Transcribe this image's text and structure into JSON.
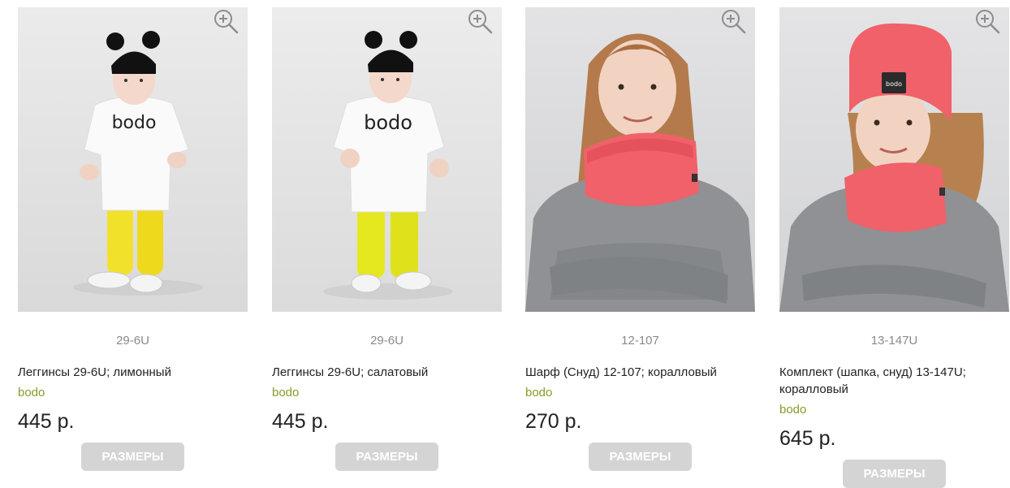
{
  "products": [
    {
      "sku": "29-6U",
      "name": "Леггинсы 29-6U; лимонный",
      "brand": "bodo",
      "price": "445 р.",
      "button_label": "РАЗМЕРЫ",
      "photo_text": "bodo",
      "colors": {
        "bottoms": "#f2e12a",
        "hat": "#111111"
      }
    },
    {
      "sku": "29-6U",
      "name": "Леггинсы 29-6U; салатовый",
      "brand": "bodo",
      "price": "445 р.",
      "button_label": "РАЗМЕРЫ",
      "photo_text": "bodo",
      "colors": {
        "bottoms": "#e6e81f",
        "hat": "#111111"
      }
    },
    {
      "sku": "12-107",
      "name": "Шарф (Снуд) 12-107; коралловый",
      "brand": "bodo",
      "price": "270 р.",
      "button_label": "РАЗМЕРЫ",
      "colors": {
        "scarf": "#f0616a",
        "sweater": "#8f9194"
      }
    },
    {
      "sku": "13-147U",
      "name": "Комплект (шапка, снуд) 13-147U; коралловый",
      "brand": "bodo",
      "price": "645 р.",
      "button_label": "РАЗМЕРЫ",
      "photo_text": "bodo",
      "colors": {
        "scarf": "#f0616a",
        "hat": "#f0616a",
        "sweater": "#8f9194"
      }
    }
  ],
  "icons": {
    "zoom": "zoom-in-icon"
  },
  "theme": {
    "brand_color": "#8a9a2a",
    "button_bg": "#d4d4d4",
    "sku_color": "#8a8a8a"
  }
}
